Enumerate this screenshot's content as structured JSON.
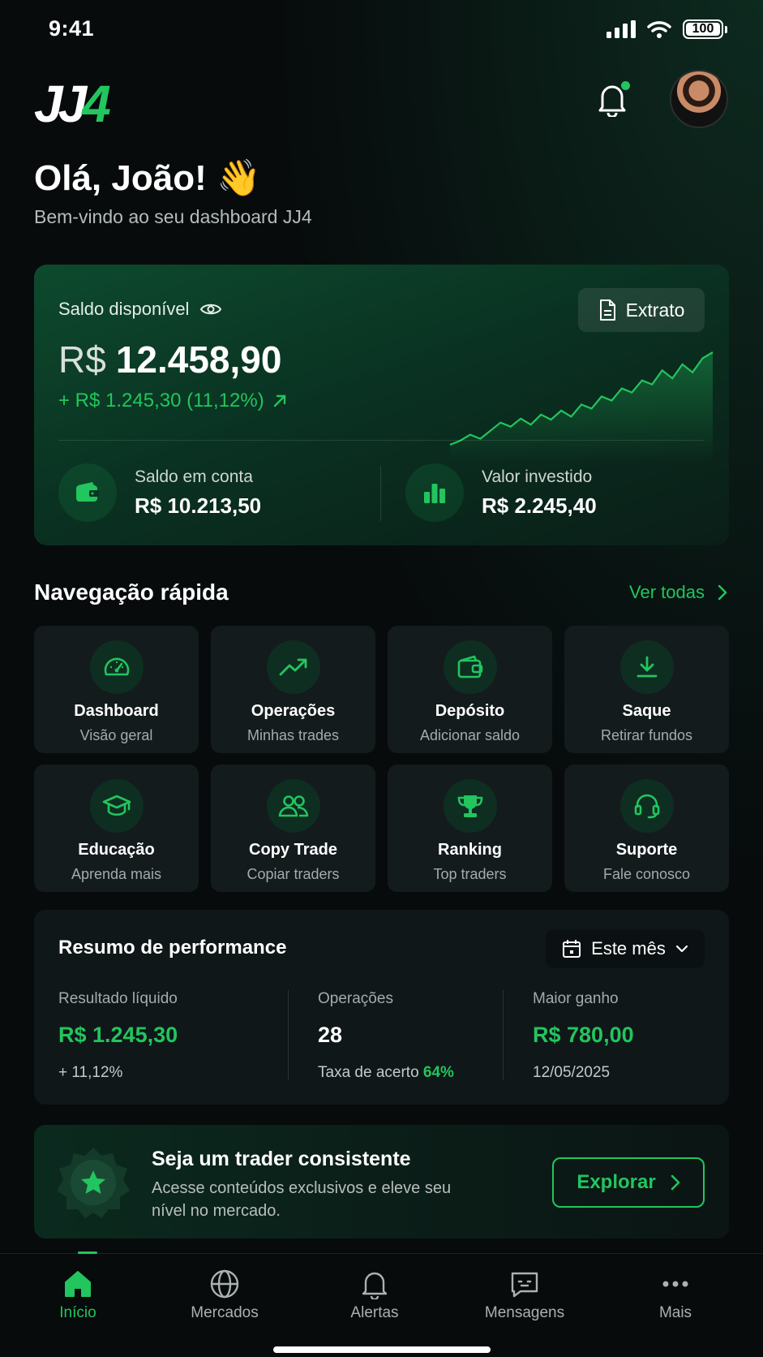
{
  "status_bar": {
    "time": "9:41",
    "battery": "100"
  },
  "header": {
    "logo_main": "JJ",
    "logo_accent": "4",
    "greeting": "Olá, João! 👋",
    "subtitle": "Bem-vindo ao seu dashboard JJ4"
  },
  "balance": {
    "label": "Saldo disponível",
    "statement_button": "Extrato",
    "currency": "R$",
    "value": "12.458,90",
    "change": "+ R$ 1.245,30 (11,12%)",
    "sparkline": [
      8,
      12,
      18,
      14,
      22,
      30,
      26,
      34,
      28,
      38,
      33,
      42,
      36,
      48,
      44,
      56,
      52,
      64,
      60,
      72,
      68,
      82,
      74,
      88,
      80,
      94,
      100
    ],
    "account_label": "Saldo em conta",
    "account_value": "R$ 10.213,50",
    "invested_label": "Valor investido",
    "invested_value": "R$ 2.245,40"
  },
  "quick_nav": {
    "title": "Navegação rápida",
    "see_all": "Ver todas",
    "items": [
      {
        "title": "Dashboard",
        "sub": "Visão geral",
        "icon": "gauge-icon"
      },
      {
        "title": "Operações",
        "sub": "Minhas trades",
        "icon": "trending-up-icon"
      },
      {
        "title": "Depósito",
        "sub": "Adicionar saldo",
        "icon": "wallet-icon"
      },
      {
        "title": "Saque",
        "sub": "Retirar fundos",
        "icon": "download-icon"
      },
      {
        "title": "Educação",
        "sub": "Aprenda mais",
        "icon": "graduation-cap-icon"
      },
      {
        "title": "Copy Trade",
        "sub": "Copiar traders",
        "icon": "users-icon"
      },
      {
        "title": "Ranking",
        "sub": "Top traders",
        "icon": "trophy-icon"
      },
      {
        "title": "Suporte",
        "sub": "Fale conosco",
        "icon": "headset-icon"
      }
    ]
  },
  "performance": {
    "title": "Resumo de performance",
    "period": "Este mês",
    "net_label": "Resultado líquido",
    "net_value": "R$ 1.245,30",
    "net_change": "+ 11,12%",
    "ops_label": "Operações",
    "ops_value": "28",
    "hit_rate_label": "Taxa de acerto",
    "hit_rate": "64%",
    "best_label": "Maior ganho",
    "best_value": "R$ 780,00",
    "best_date": "12/05/2025"
  },
  "promo": {
    "title": "Seja um trader consistente",
    "text": "Acesse conteúdos exclusivos e eleve seu nível no mercado.",
    "button": "Explorar"
  },
  "bottom_nav": [
    {
      "label": "Início",
      "icon": "home-icon"
    },
    {
      "label": "Mercados",
      "icon": "globe-icon"
    },
    {
      "label": "Alertas",
      "icon": "bell-icon"
    },
    {
      "label": "Mensagens",
      "icon": "message-icon"
    },
    {
      "label": "Mais",
      "icon": "more-icon"
    }
  ],
  "colors": {
    "accent": "#22c55e",
    "background": "#070b0c",
    "card": "#141b1c"
  }
}
